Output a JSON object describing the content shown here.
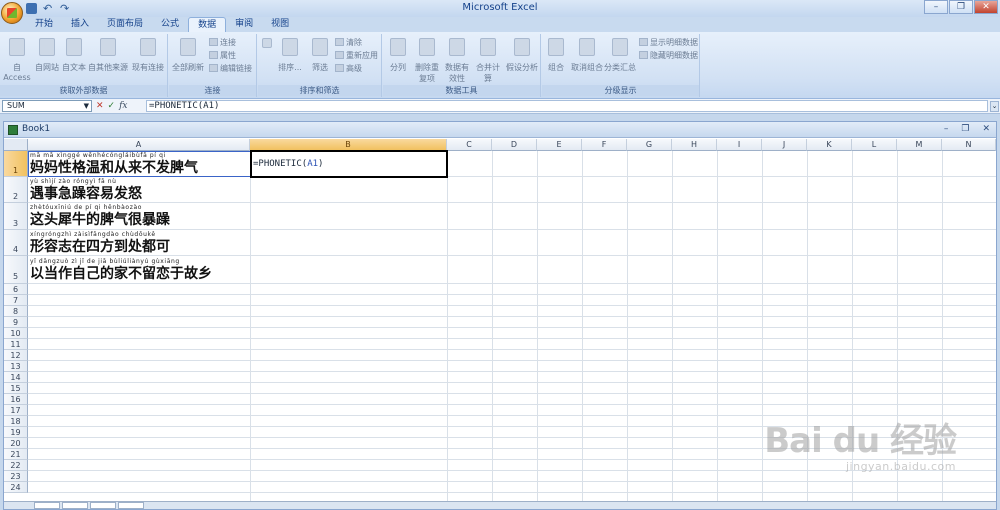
{
  "app": {
    "title": "Microsoft Excel"
  },
  "tabs": [
    "开始",
    "插入",
    "页面布局",
    "公式",
    "数据",
    "审阅",
    "视图"
  ],
  "active_tab": "数据",
  "ribbon": {
    "groups": [
      {
        "label": "获取外部数据",
        "buttons": [
          "自 Access",
          "自网站",
          "自文本",
          "自其他来源",
          "现有连接"
        ]
      },
      {
        "label": "连接",
        "buttons": [
          "全部刷新"
        ],
        "small": [
          "连接",
          "属性",
          "编辑链接"
        ]
      },
      {
        "label": "排序和筛选",
        "buttons": [
          "排序...",
          "筛选"
        ],
        "small": [
          "清除",
          "重新应用",
          "高级"
        ]
      },
      {
        "label": "数据工具",
        "buttons": [
          "分列",
          "删除重复项",
          "数据有效性",
          "合并计算",
          "假设分析"
        ]
      },
      {
        "label": "分级显示",
        "buttons": [
          "组合",
          "取消组合",
          "分类汇总"
        ],
        "small": [
          "显示明细数据",
          "隐藏明细数据"
        ]
      }
    ]
  },
  "formula_bar": {
    "name_box": "SUM",
    "formula": "=PHONETIC(A1)",
    "fx": "fx"
  },
  "workbook": {
    "name": "Book1"
  },
  "columns": [
    "A",
    "B",
    "C",
    "D",
    "E",
    "F",
    "G",
    "H",
    "I",
    "J",
    "K",
    "L",
    "M",
    "N"
  ],
  "selected_column": "B",
  "rows": [
    "1",
    "2",
    "3",
    "4",
    "5",
    "6",
    "7",
    "8",
    "9",
    "10",
    "11",
    "12",
    "13",
    "14",
    "15",
    "16",
    "17",
    "18",
    "19",
    "20",
    "21",
    "22",
    "23",
    "24"
  ],
  "selected_row": "1",
  "cells_a": [
    {
      "pinyin": "mā mā xìnggé wēnhécóngláibùfā pí qi",
      "text": "妈妈性格温和从来不发脾气"
    },
    {
      "pinyin": "yù shìjí zào róngyì fā nù",
      "text": "遇事急躁容易发怒"
    },
    {
      "pinyin": "zhètóuxīniú de pí qi hěnbàozào",
      "text": "这头犀牛的脾气很暴躁"
    },
    {
      "pinyin": "xíngróngzhì zàisìfāngdào chùdōukě",
      "text": "形容志在四方到处都可"
    },
    {
      "pinyin": "yǐ dāngzuò zì jǐ de jiā bùliúliànyú gùxiāng",
      "text": "以当作自己的家不留恋于故乡"
    }
  ],
  "active_cell": {
    "prefix": "=PHONETIC(",
    "ref": "A1",
    "suffix": ")"
  },
  "watermark": {
    "brand": "Bai du 经验",
    "url": "jingyan.baidu.com"
  }
}
